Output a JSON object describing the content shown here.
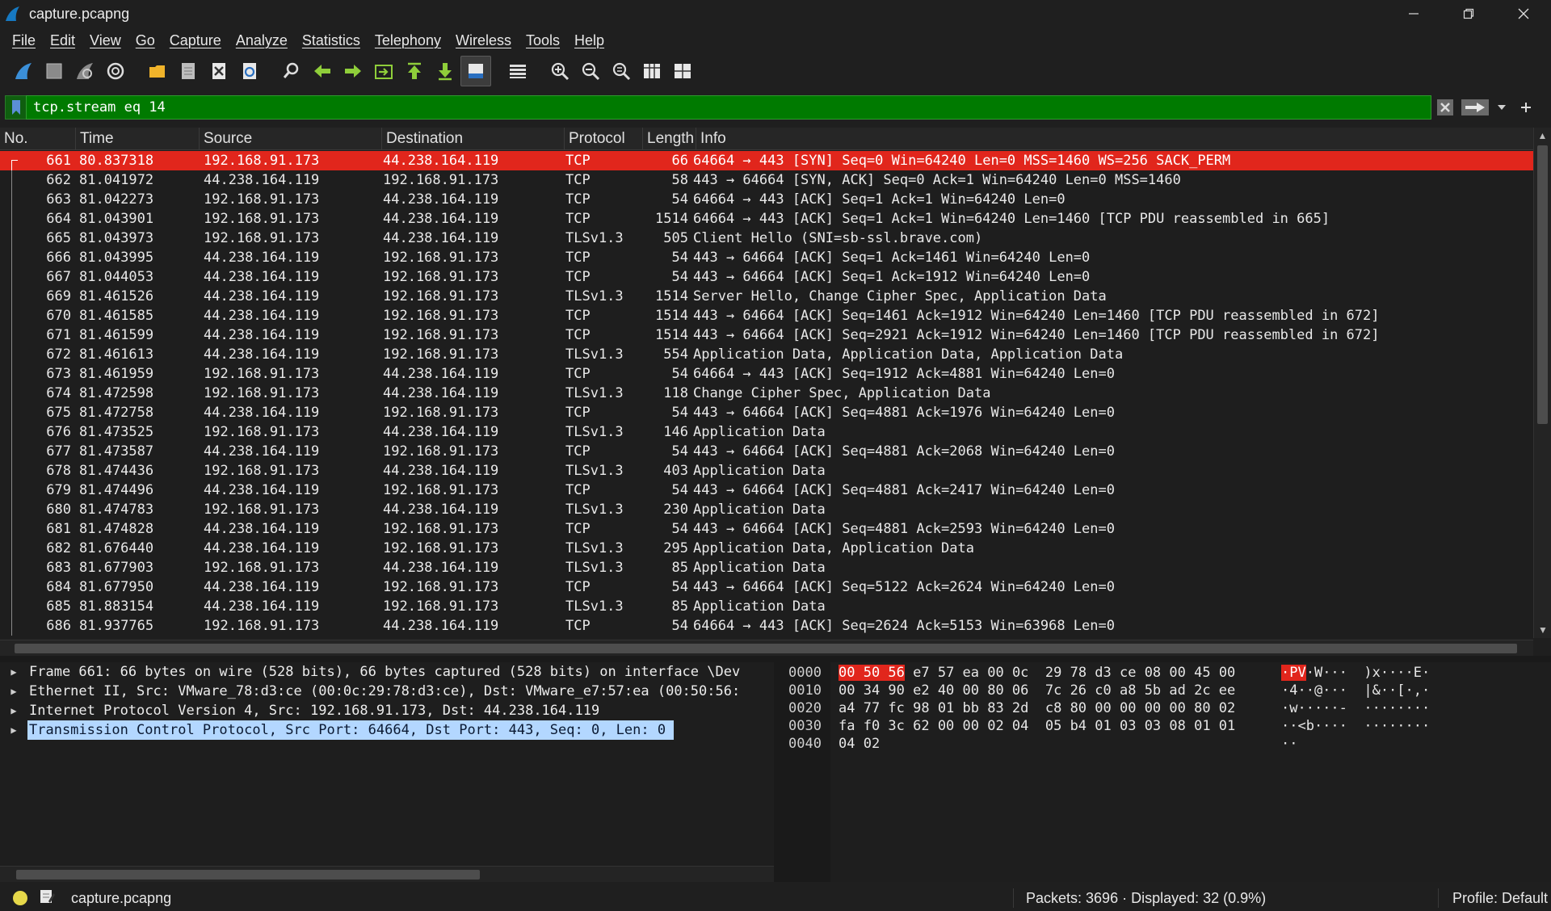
{
  "window": {
    "title": "capture.pcapng",
    "minimize_glyph": "—",
    "maximize_glyph": "❐",
    "close_glyph": "✕"
  },
  "menu": [
    "File",
    "Edit",
    "View",
    "Go",
    "Capture",
    "Analyze",
    "Statistics",
    "Telephony",
    "Wireless",
    "Tools",
    "Help"
  ],
  "toolbar": {
    "icons": [
      "shark-fin-start-icon",
      "stop-capture-icon",
      "restart-capture-icon",
      "capture-options-icon",
      "open-file-icon",
      "save-file-icon",
      "close-file-icon",
      "reload-file-icon",
      "find-packet-icon",
      "go-back-icon",
      "go-forward-icon",
      "go-to-packet-icon",
      "go-first-icon",
      "go-last-icon",
      "autoscroll-icon",
      "colorize-icon",
      "zoom-in-icon",
      "zoom-out-icon",
      "zoom-normal-icon",
      "resize-columns-icon",
      "time-reference-icon"
    ]
  },
  "filter": {
    "value": "tcp.stream eq 14",
    "bg_color": "#007a00"
  },
  "packet_list": {
    "columns": [
      "No.",
      "Time",
      "Source",
      "Destination",
      "Protocol",
      "Length",
      "Info"
    ],
    "selected_color": "#e1261c",
    "rows": [
      {
        "no": "661",
        "time": "80.837318",
        "src": "192.168.91.173",
        "dst": "44.238.164.119",
        "proto": "TCP",
        "len": "66",
        "info": "64664 → 443 [SYN] Seq=0 Win=64240 Len=0 MSS=1460 WS=256 SACK_PERM"
      },
      {
        "no": "662",
        "time": "81.041972",
        "src": "44.238.164.119",
        "dst": "192.168.91.173",
        "proto": "TCP",
        "len": "58",
        "info": "443 → 64664 [SYN, ACK] Seq=0 Ack=1 Win=64240 Len=0 MSS=1460"
      },
      {
        "no": "663",
        "time": "81.042273",
        "src": "192.168.91.173",
        "dst": "44.238.164.119",
        "proto": "TCP",
        "len": "54",
        "info": "64664 → 443 [ACK] Seq=1 Ack=1 Win=64240 Len=0"
      },
      {
        "no": "664",
        "time": "81.043901",
        "src": "192.168.91.173",
        "dst": "44.238.164.119",
        "proto": "TCP",
        "len": "1514",
        "info": "64664 → 443 [ACK] Seq=1 Ack=1 Win=64240 Len=1460 [TCP PDU reassembled in 665]"
      },
      {
        "no": "665",
        "time": "81.043973",
        "src": "192.168.91.173",
        "dst": "44.238.164.119",
        "proto": "TLSv1.3",
        "len": "505",
        "info": "Client Hello (SNI=sb-ssl.brave.com)"
      },
      {
        "no": "666",
        "time": "81.043995",
        "src": "44.238.164.119",
        "dst": "192.168.91.173",
        "proto": "TCP",
        "len": "54",
        "info": "443 → 64664 [ACK] Seq=1 Ack=1461 Win=64240 Len=0"
      },
      {
        "no": "667",
        "time": "81.044053",
        "src": "44.238.164.119",
        "dst": "192.168.91.173",
        "proto": "TCP",
        "len": "54",
        "info": "443 → 64664 [ACK] Seq=1 Ack=1912 Win=64240 Len=0"
      },
      {
        "no": "669",
        "time": "81.461526",
        "src": "44.238.164.119",
        "dst": "192.168.91.173",
        "proto": "TLSv1.3",
        "len": "1514",
        "info": "Server Hello, Change Cipher Spec, Application Data"
      },
      {
        "no": "670",
        "time": "81.461585",
        "src": "44.238.164.119",
        "dst": "192.168.91.173",
        "proto": "TCP",
        "len": "1514",
        "info": "443 → 64664 [ACK] Seq=1461 Ack=1912 Win=64240 Len=1460 [TCP PDU reassembled in 672]"
      },
      {
        "no": "671",
        "time": "81.461599",
        "src": "44.238.164.119",
        "dst": "192.168.91.173",
        "proto": "TCP",
        "len": "1514",
        "info": "443 → 64664 [ACK] Seq=2921 Ack=1912 Win=64240 Len=1460 [TCP PDU reassembled in 672]"
      },
      {
        "no": "672",
        "time": "81.461613",
        "src": "44.238.164.119",
        "dst": "192.168.91.173",
        "proto": "TLSv1.3",
        "len": "554",
        "info": "Application Data, Application Data, Application Data"
      },
      {
        "no": "673",
        "time": "81.461959",
        "src": "192.168.91.173",
        "dst": "44.238.164.119",
        "proto": "TCP",
        "len": "54",
        "info": "64664 → 443 [ACK] Seq=1912 Ack=4881 Win=64240 Len=0"
      },
      {
        "no": "674",
        "time": "81.472598",
        "src": "192.168.91.173",
        "dst": "44.238.164.119",
        "proto": "TLSv1.3",
        "len": "118",
        "info": "Change Cipher Spec, Application Data"
      },
      {
        "no": "675",
        "time": "81.472758",
        "src": "44.238.164.119",
        "dst": "192.168.91.173",
        "proto": "TCP",
        "len": "54",
        "info": "443 → 64664 [ACK] Seq=4881 Ack=1976 Win=64240 Len=0"
      },
      {
        "no": "676",
        "time": "81.473525",
        "src": "192.168.91.173",
        "dst": "44.238.164.119",
        "proto": "TLSv1.3",
        "len": "146",
        "info": "Application Data"
      },
      {
        "no": "677",
        "time": "81.473587",
        "src": "44.238.164.119",
        "dst": "192.168.91.173",
        "proto": "TCP",
        "len": "54",
        "info": "443 → 64664 [ACK] Seq=4881 Ack=2068 Win=64240 Len=0"
      },
      {
        "no": "678",
        "time": "81.474436",
        "src": "192.168.91.173",
        "dst": "44.238.164.119",
        "proto": "TLSv1.3",
        "len": "403",
        "info": "Application Data"
      },
      {
        "no": "679",
        "time": "81.474496",
        "src": "44.238.164.119",
        "dst": "192.168.91.173",
        "proto": "TCP",
        "len": "54",
        "info": "443 → 64664 [ACK] Seq=4881 Ack=2417 Win=64240 Len=0"
      },
      {
        "no": "680",
        "time": "81.474783",
        "src": "192.168.91.173",
        "dst": "44.238.164.119",
        "proto": "TLSv1.3",
        "len": "230",
        "info": "Application Data"
      },
      {
        "no": "681",
        "time": "81.474828",
        "src": "44.238.164.119",
        "dst": "192.168.91.173",
        "proto": "TCP",
        "len": "54",
        "info": "443 → 64664 [ACK] Seq=4881 Ack=2593 Win=64240 Len=0"
      },
      {
        "no": "682",
        "time": "81.676440",
        "src": "44.238.164.119",
        "dst": "192.168.91.173",
        "proto": "TLSv1.3",
        "len": "295",
        "info": "Application Data, Application Data"
      },
      {
        "no": "683",
        "time": "81.677903",
        "src": "192.168.91.173",
        "dst": "44.238.164.119",
        "proto": "TLSv1.3",
        "len": "85",
        "info": "Application Data"
      },
      {
        "no": "684",
        "time": "81.677950",
        "src": "44.238.164.119",
        "dst": "192.168.91.173",
        "proto": "TCP",
        "len": "54",
        "info": "443 → 64664 [ACK] Seq=5122 Ack=2624 Win=64240 Len=0"
      },
      {
        "no": "685",
        "time": "81.883154",
        "src": "44.238.164.119",
        "dst": "192.168.91.173",
        "proto": "TLSv1.3",
        "len": "85",
        "info": "Application Data"
      },
      {
        "no": "686",
        "time": "81.937765",
        "src": "192.168.91.173",
        "dst": "44.238.164.119",
        "proto": "TCP",
        "len": "54",
        "info": "64664 → 443 [ACK] Seq=2624 Ack=5153 Win=63968 Len=0"
      }
    ]
  },
  "details": {
    "rows": [
      {
        "text": "Frame 661: 66 bytes on wire (528 bits), 66 bytes captured (528 bits) on interface \\Dev",
        "selected": false
      },
      {
        "text": "Ethernet II, Src: VMware_78:d3:ce (00:0c:29:78:d3:ce), Dst: VMware_e7:57:ea (00:50:56:",
        "selected": false
      },
      {
        "text": "Internet Protocol Version 4, Src: 192.168.91.173, Dst: 44.238.164.119",
        "selected": false
      },
      {
        "text": "Transmission Control Protocol, Src Port: 64664, Dst Port: 443, Seq: 0, Len: 0",
        "selected": true
      }
    ]
  },
  "bytes": {
    "rows": [
      {
        "offset": "0000",
        "hex_hl": "00 50 56",
        "hex_rest": " e7 57 ea 00 0c  29 78 d3 ce 08 00 45 00",
        "asc_hl": "·PV",
        "asc_rest": "·W···  )x····E·"
      },
      {
        "offset": "0010",
        "hex_hl": "",
        "hex_rest": "00 34 90 e2 40 00 80 06  7c 26 c0 a8 5b ad 2c ee",
        "asc_hl": "",
        "asc_rest": "·4··@···  |&··[·,·"
      },
      {
        "offset": "0020",
        "hex_hl": "",
        "hex_rest": "a4 77 fc 98 01 bb 83 2d  c8 80 00 00 00 00 80 02",
        "asc_hl": "",
        "asc_rest": "·w·····-  ········"
      },
      {
        "offset": "0030",
        "hex_hl": "",
        "hex_rest": "fa f0 3c 62 00 00 02 04  05 b4 01 03 03 08 01 01",
        "asc_hl": "",
        "asc_rest": "··<b····  ········"
      },
      {
        "offset": "0040",
        "hex_hl": "",
        "hex_rest": "04 02",
        "asc_hl": "",
        "asc_rest": "··"
      }
    ]
  },
  "status": {
    "file": "capture.pcapng",
    "packets": "Packets: 3696 · Displayed: 32 (0.9%)",
    "profile": "Profile: Default"
  }
}
